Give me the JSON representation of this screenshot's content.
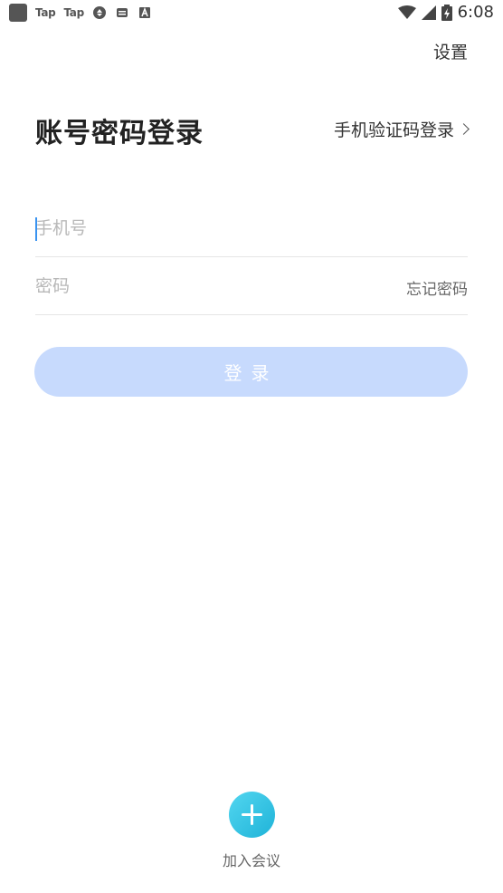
{
  "status_bar": {
    "left_items": [
      "Tap",
      "Tap"
    ],
    "time": "6:08"
  },
  "header": {
    "settings_label": "设置"
  },
  "login": {
    "title": "账号密码登录",
    "sms_login_label": "手机验证码登录",
    "phone_placeholder": "手机号",
    "password_placeholder": "密码",
    "forgot_password_label": "忘记密码",
    "login_button_label": "登录"
  },
  "join_meeting": {
    "label": "加入会议"
  },
  "colors": {
    "login_button_bg": "#c7dafd",
    "join_circle": "#2bbde0",
    "cursor": "#3a93f0"
  }
}
